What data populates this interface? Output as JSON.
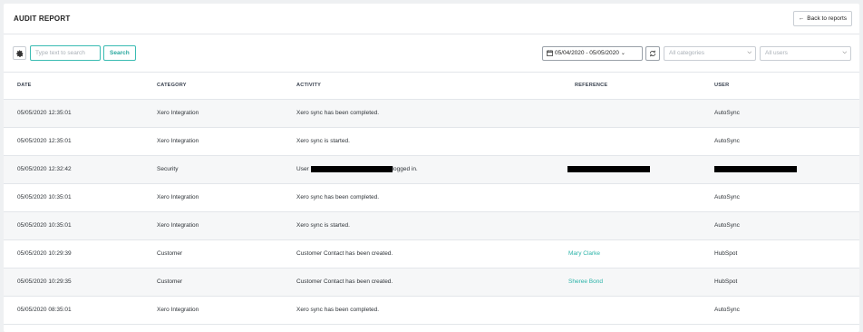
{
  "header": {
    "title": "AUDIT REPORT",
    "back_label": "Back to reports"
  },
  "toolbar": {
    "search_placeholder": "Type text to search",
    "search_label": "Search",
    "date_range": "05/04/2020 - 05/05/2020",
    "category_placeholder": "All categories",
    "user_placeholder": "All users"
  },
  "table": {
    "columns": [
      "DATE",
      "CATEGORY",
      "ACTIVITY",
      "REFERENCE",
      "USER"
    ],
    "rows": [
      {
        "date": "05/05/2020 12:35:01",
        "category": "Xero Integration",
        "activity": "Xero sync has been completed.",
        "reference": "",
        "user": "AutoSync"
      },
      {
        "date": "05/05/2020 12:35:01",
        "category": "Xero Integration",
        "activity": "Xero sync is started.",
        "reference": "",
        "user": "AutoSync"
      },
      {
        "date": "05/05/2020 12:32:42",
        "category": "Security",
        "activity_prefix": "User",
        "activity_suffix": "logged in.",
        "reference": "",
        "user": ""
      },
      {
        "date": "05/05/2020 10:35:01",
        "category": "Xero Integration",
        "activity": "Xero sync has been completed.",
        "reference": "",
        "user": "AutoSync"
      },
      {
        "date": "05/05/2020 10:35:01",
        "category": "Xero Integration",
        "activity": "Xero sync is started.",
        "reference": "",
        "user": "AutoSync"
      },
      {
        "date": "05/05/2020 10:29:39",
        "category": "Customer",
        "activity": "Customer Contact has been created.",
        "reference": "Mary Clarke",
        "user": "HubSpot"
      },
      {
        "date": "05/05/2020 10:29:35",
        "category": "Customer",
        "activity": "Customer Contact has been created.",
        "reference": "Sheree Bond",
        "user": "HubSpot"
      },
      {
        "date": "05/05/2020 08:35:01",
        "category": "Xero Integration",
        "activity": "Xero sync has been completed.",
        "reference": "",
        "user": "AutoSync"
      }
    ]
  },
  "colors": {
    "accent": "#2bb3a8",
    "border": "#e3e6ea",
    "background": "#eef0f2"
  }
}
